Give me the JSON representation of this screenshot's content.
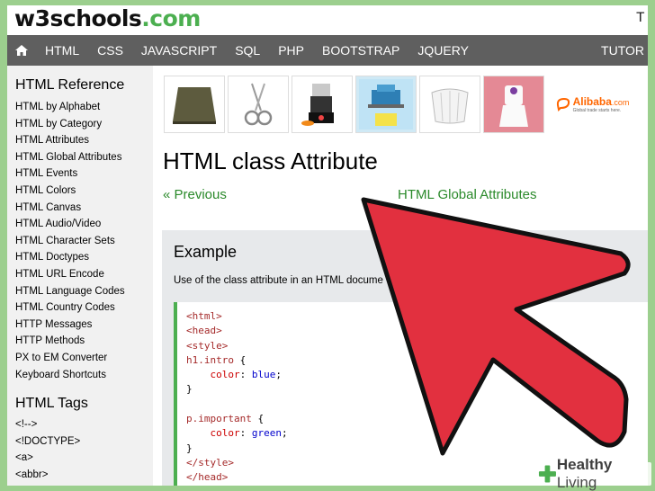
{
  "brand": {
    "name_a": "w3schools",
    "name_b": ".com"
  },
  "topright_text": "T",
  "nav": {
    "home_icon": "home-icon",
    "items": [
      "HTML",
      "CSS",
      "JAVASCRIPT",
      "SQL",
      "PHP",
      "BOOTSTRAP",
      "JQUERY"
    ],
    "right": "TUTOR"
  },
  "sidebar": {
    "reference_heading": "HTML Reference",
    "reference_links": [
      "HTML by Alphabet",
      "HTML by Category",
      "HTML Attributes",
      "HTML Global Attributes",
      "HTML Events",
      "HTML Colors",
      "HTML Canvas",
      "HTML Audio/Video",
      "HTML Character Sets",
      "HTML Doctypes",
      "HTML URL Encode",
      "HTML Language Codes",
      "HTML Country Codes",
      "HTTP Messages",
      "HTTP Methods",
      "PX to EM Converter",
      "Keyboard Shortcuts"
    ],
    "tags_heading": "HTML Tags",
    "tag_links": [
      "<!-->",
      "<!DOCTYPE>",
      "<a>",
      "<abbr>"
    ]
  },
  "ads": {
    "alibaba_name": "Alibaba",
    "alibaba_suffix": ".com",
    "alibaba_tagline": "Global trade starts here."
  },
  "main": {
    "title": "HTML class Attribute",
    "prev": "« Previous",
    "next": "HTML Global Attributes",
    "example_title": "Example",
    "example_desc": "Use of the class attribute in an HTML docume"
  },
  "code_lines": [
    [
      {
        "t": "tag",
        "v": "<html>"
      }
    ],
    [
      {
        "t": "tag",
        "v": "<head>"
      }
    ],
    [
      {
        "t": "tag",
        "v": "<style>"
      }
    ],
    [
      {
        "t": "sel",
        "v": "h1.intro"
      },
      {
        "t": "punc",
        "v": " {"
      }
    ],
    [
      {
        "t": "punc",
        "v": "    "
      },
      {
        "t": "prop",
        "v": "color"
      },
      {
        "t": "punc",
        "v": ": "
      },
      {
        "t": "val",
        "v": "blue"
      },
      {
        "t": "punc",
        "v": ";"
      }
    ],
    [
      {
        "t": "punc",
        "v": "}"
      }
    ],
    [],
    [
      {
        "t": "sel",
        "v": "p.important"
      },
      {
        "t": "punc",
        "v": " {"
      }
    ],
    [
      {
        "t": "punc",
        "v": "    "
      },
      {
        "t": "prop",
        "v": "color"
      },
      {
        "t": "punc",
        "v": ": "
      },
      {
        "t": "val",
        "v": "green"
      },
      {
        "t": "punc",
        "v": ";"
      }
    ],
    [
      {
        "t": "punc",
        "v": "}"
      }
    ],
    [
      {
        "t": "tag",
        "v": "</style>"
      }
    ],
    [
      {
        "t": "tag",
        "v": "</head>"
      }
    ]
  ],
  "watermark": {
    "bold": "Healthy",
    "rest": " Living"
  },
  "colors": {
    "accent": "#4CAF50",
    "nav_bg": "#5f5f5f",
    "arrow": "#e2303f"
  }
}
